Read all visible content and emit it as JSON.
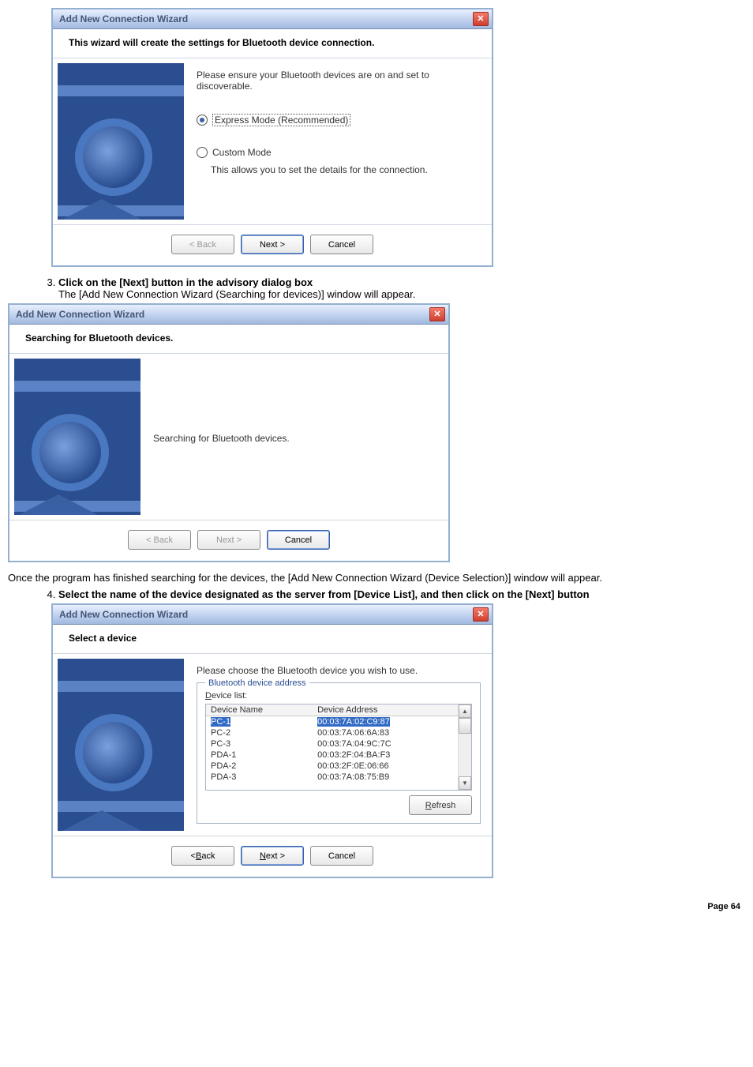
{
  "dialog1": {
    "title": "Add New Connection Wizard",
    "heading": "This wizard will create the settings for Bluetooth device connection.",
    "instruction": "Please ensure your Bluetooth devices are on and set to discoverable.",
    "radio_express": "Express Mode (Recommended)",
    "radio_custom": "Custom Mode",
    "custom_desc": "This allows you to set the details for the connection.",
    "btn_back": "< Back",
    "btn_next": "Next >",
    "btn_cancel": "Cancel"
  },
  "step3": {
    "number": "3.",
    "title": "Click on the [Next] button in the advisory dialog box",
    "text": "The [Add New Connection Wizard (Searching for devices)] window will appear."
  },
  "dialog2": {
    "title": "Add New Connection Wizard",
    "heading": "Searching for Bluetooth devices.",
    "status": "Searching for Bluetooth devices.",
    "btn_back": "< Back",
    "btn_next": "Next >",
    "btn_cancel": "Cancel"
  },
  "midtext": "Once the program has finished searching for the devices, the [Add New Connection Wizard (Device Selection)] window will appear.",
  "step4": {
    "number": "4.",
    "title": "Select the name of the device designated as the server from [Device List], and then click on the [Next] button"
  },
  "dialog3": {
    "title": "Add New Connection Wizard",
    "heading": "Select a device",
    "instruction": "Please choose the Bluetooth device you wish to use.",
    "groupbox": "Bluetooth device address",
    "list_label": "Device list:",
    "col_name": "Device Name",
    "col_addr": "Device Address",
    "rows": [
      {
        "name": "PC-1",
        "addr": "00:03:7A:02:C9:87"
      },
      {
        "name": "PC-2",
        "addr": "00:03:7A:06:6A:83"
      },
      {
        "name": "PC-3",
        "addr": "00:03:7A:04:9C:7C"
      },
      {
        "name": "PDA-1",
        "addr": "00:03:2F:04:BA:F3"
      },
      {
        "name": "PDA-2",
        "addr": "00:03:2F:0E:06:66"
      },
      {
        "name": "PDA-3",
        "addr": "00:03:7A:08:75:B9"
      }
    ],
    "btn_refresh": "Refresh",
    "btn_back": "< Back",
    "btn_next": "Next >",
    "btn_cancel": "Cancel"
  },
  "footer": "Page 64"
}
